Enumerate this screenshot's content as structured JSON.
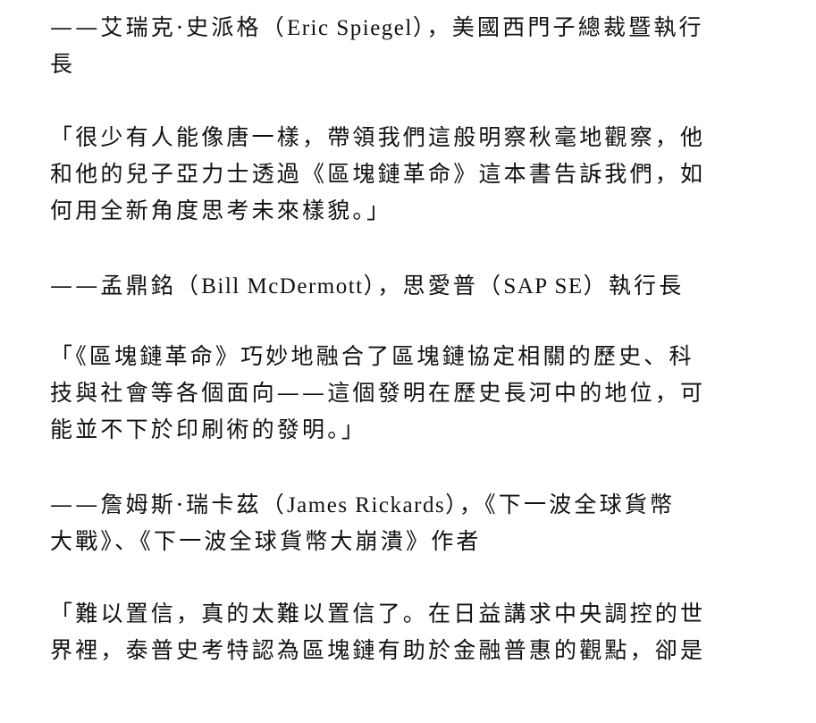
{
  "paragraphs": [
    {
      "type": "attribution",
      "lines": [
        "——艾瑞克·史派格（Eric Spiegel），美國西門子總裁暨執行",
        "長"
      ]
    },
    {
      "type": "quote",
      "lines": [
        "「很少有人能像唐一樣，帶領我們這般明察秋毫地觀察，他",
        "和他的兒子亞力士透過《區塊鏈革命》這本書告訴我們，如",
        "何用全新角度思考未來樣貌。」"
      ]
    },
    {
      "type": "attribution",
      "lines": [
        "——孟鼎銘（Bill McDermott），思愛普（SAP SE）執行長"
      ]
    },
    {
      "type": "quote",
      "lines": [
        "「《區塊鏈革命》巧妙地融合了區塊鏈協定相關的歷史、科",
        "技與社會等各個面向——這個發明在歷史長河中的地位，可",
        "能並不下於印刷術的發明。」"
      ]
    },
    {
      "type": "attribution",
      "lines": [
        "——詹姆斯·瑞卡茲（James Rickards），《下一波全球貨幣",
        "大戰》、《下一波全球貨幣大崩潰》作者"
      ]
    },
    {
      "type": "quote",
      "lines": [
        "「難以置信，真的太難以置信了。在日益講求中央調控的世",
        "界裡，泰普史考特認為區塊鏈有助於金融普惠的觀點，卻是"
      ]
    }
  ]
}
